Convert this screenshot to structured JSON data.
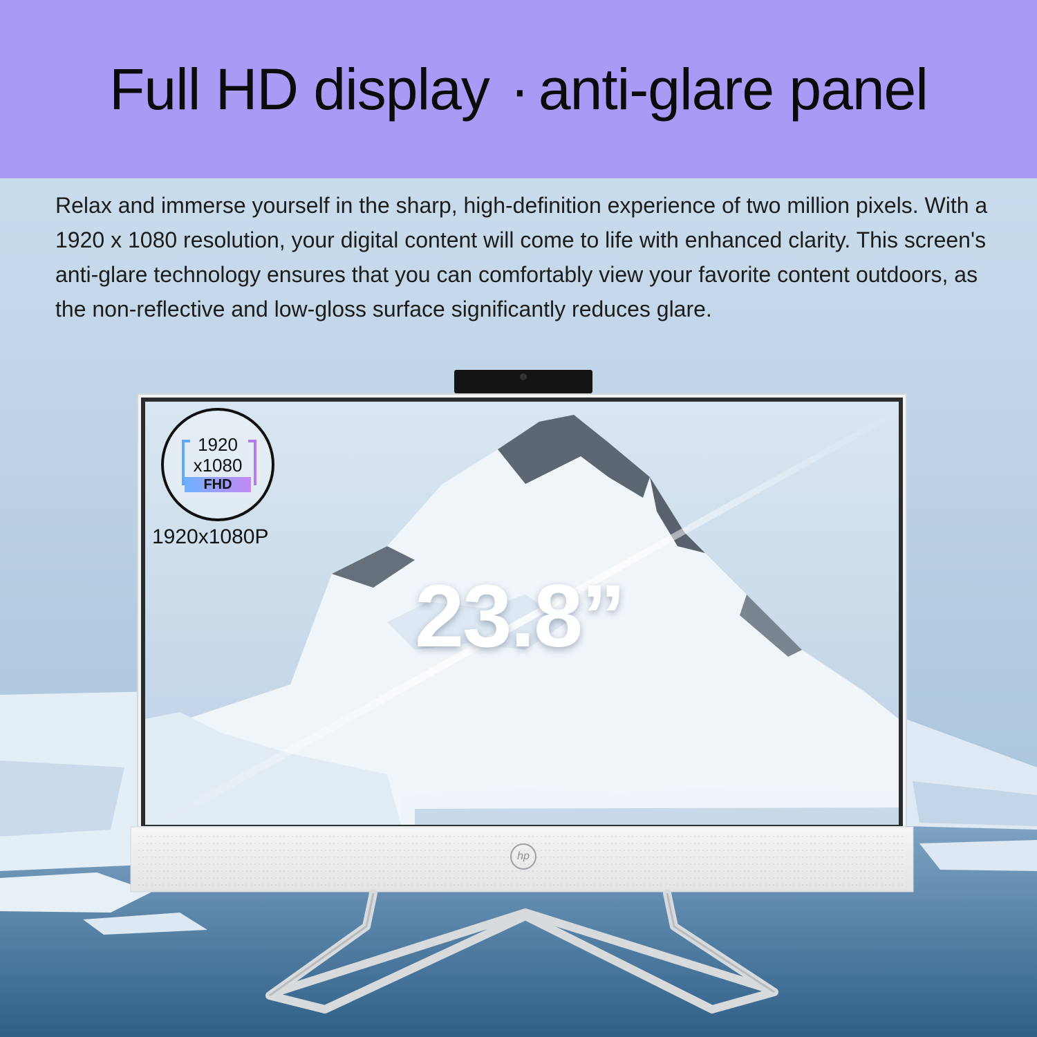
{
  "header": {
    "title_part1": "Full HD display",
    "separator": "·",
    "title_part2": "anti-glare panel"
  },
  "description": "Relax and immerse yourself in the sharp, high-definition experience of two million pixels. With a 1920 x 1080 resolution, your digital content will come to life with enhanced clarity. This screen's anti-glare technology ensures that you can comfortably view your favorite content outdoors, as the non-reflective and low-gloss surface significantly reduces glare.",
  "badge": {
    "line1": "1920",
    "line2": "x1080",
    "tag": "FHD",
    "caption": "1920x1080P"
  },
  "screen_size": "23.8”",
  "brand": "hp",
  "colors": {
    "header_bg": "#a89bf6",
    "text": "#1c1c1c",
    "badge_blue": "#62a6ff",
    "badge_purple": "#b57cf2"
  }
}
